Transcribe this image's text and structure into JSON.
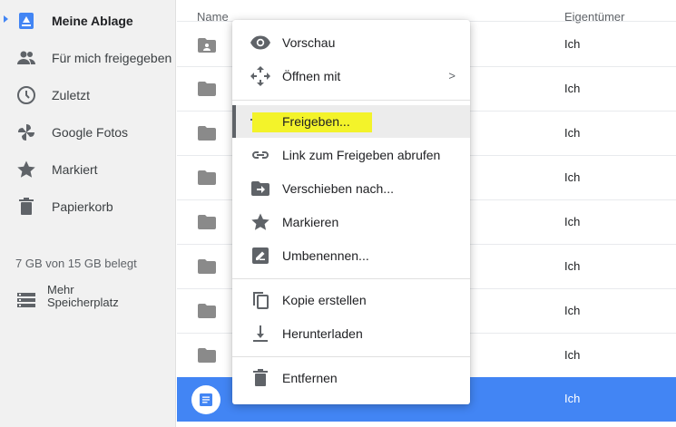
{
  "sidebar": {
    "items": [
      {
        "label": "Meine Ablage",
        "icon": "drive-icon"
      },
      {
        "label": "Für mich freigegeben",
        "icon": "people-icon"
      },
      {
        "label": "Zuletzt",
        "icon": "clock-icon"
      },
      {
        "label": "Google Fotos",
        "icon": "pinwheel-icon"
      },
      {
        "label": "Markiert",
        "icon": "star-icon"
      },
      {
        "label": "Papierkorb",
        "icon": "trash-icon"
      }
    ],
    "storage": "7 GB von 15 GB belegt",
    "more_storage": "Mehr Speicherplatz"
  },
  "list": {
    "header_name": "Name",
    "header_owner": "Eigentümer",
    "rows": [
      {
        "owner": "Ich"
      },
      {
        "owner": "Ich"
      },
      {
        "owner": "Ich"
      },
      {
        "owner": "Ich"
      },
      {
        "owner": "Ich"
      },
      {
        "owner": "Ich"
      },
      {
        "owner": "Ich"
      },
      {
        "owner": "Ich"
      },
      {
        "owner": "Ich"
      }
    ]
  },
  "menu": {
    "items": [
      {
        "label": "Vorschau",
        "icon": "eye-icon"
      },
      {
        "label": "Öffnen mit",
        "icon": "move-arrows-icon",
        "submenu": ">"
      },
      {
        "label": "Freigeben...",
        "icon": "add-person-icon"
      },
      {
        "label": "Link zum Freigeben abrufen",
        "icon": "link-icon"
      },
      {
        "label": "Verschieben nach...",
        "icon": "move-to-folder-icon"
      },
      {
        "label": "Markieren",
        "icon": "star-icon"
      },
      {
        "label": "Umbenennen...",
        "icon": "rename-icon"
      },
      {
        "label": "Kopie erstellen",
        "icon": "copy-icon"
      },
      {
        "label": "Herunterladen",
        "icon": "download-icon"
      },
      {
        "label": "Entfernen",
        "icon": "trash-icon"
      }
    ]
  },
  "colors": {
    "accent": "#4285f4",
    "highlight": "#f3f32a",
    "icon": "#5f6368"
  }
}
